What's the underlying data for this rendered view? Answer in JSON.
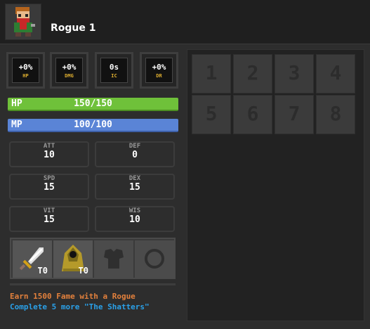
{
  "character": {
    "name": "Rogue 1"
  },
  "bonuses": [
    {
      "value": "+0%",
      "label": "HP"
    },
    {
      "value": "+0%",
      "label": "DMG"
    },
    {
      "value": "0s",
      "label": "IC"
    },
    {
      "value": "+0%",
      "label": "DR"
    }
  ],
  "bars": {
    "hp": {
      "label": "HP",
      "value": "150/150"
    },
    "mp": {
      "label": "MP",
      "value": "100/100"
    }
  },
  "stats": [
    {
      "label": "ATT",
      "value": "10"
    },
    {
      "label": "DEF",
      "value": "0"
    },
    {
      "label": "SPD",
      "value": "15"
    },
    {
      "label": "DEX",
      "value": "15"
    },
    {
      "label": "VIT",
      "value": "15"
    },
    {
      "label": "WIS",
      "value": "10"
    }
  ],
  "equipment": [
    {
      "icon": "dagger-icon",
      "tier": "T0"
    },
    {
      "icon": "cloak-icon",
      "tier": "T0"
    },
    {
      "icon": "armor-slot-icon",
      "tier": ""
    },
    {
      "icon": "ring-slot-icon",
      "tier": ""
    }
  ],
  "quests": [
    "Earn 1500 Fame with a Rogue",
    "Complete 5 more \"The Shatters\""
  ],
  "inventory": [
    "1",
    "2",
    "3",
    "4",
    "5",
    "6",
    "7",
    "8"
  ],
  "colors": {
    "hp": "#6fc13a",
    "mp": "#5a84d6",
    "quest_primary": "#e2803c",
    "quest_secondary": "#2aa0e8"
  }
}
